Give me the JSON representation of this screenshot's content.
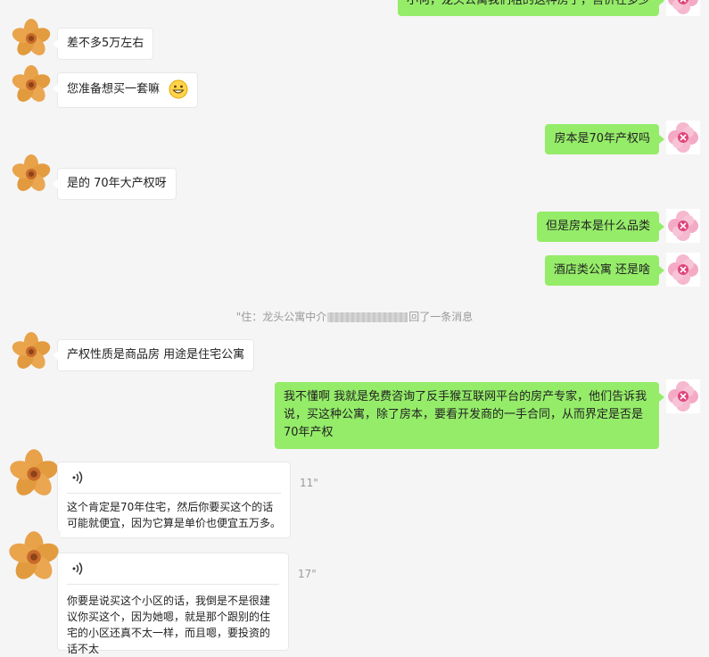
{
  "messages": {
    "m0": "小何，龙头公寓我们租的这种房子，售价在多少",
    "m1": "差不多5万左右",
    "m2": "您准备想买一套嘛",
    "m3": "房本是70年产权吗",
    "m4": "是的 70年大产权呀",
    "m5": "但是房本是什么品类",
    "m6": "酒店类公寓 还是啥",
    "m7": "产权性质是商品房 用途是住宅公寓",
    "m8": "我不懂啊 我就是免费咨询了反手猴互联网平台的房产专家，他们告诉我说，买这种公寓，除了房本，要看开发商的一手合同，从而界定是否是70年产权"
  },
  "recall": {
    "prefix": "\"住：龙头公寓中介",
    "suffix": "回了一条消息"
  },
  "voice1": {
    "duration": "11\"",
    "transcript": "这个肯定是70年住宅，然后你要买这个的话可能就便宜，因为它算是单价也便宜五万多。"
  },
  "voice2": {
    "duration": "17\"",
    "transcript": "你要是说买这个小区的话，我倒是不是很建议你买这个，因为她嗯，就是那个跟别的住宅的小区还真不太一样，而且嗯，要投资的话不太"
  },
  "icons": {
    "left_avatar": "orange-flower-avatar",
    "right_avatar": "pink-flower-avatar",
    "emoji": "grinning-face-emoji",
    "voice": "voice-wave-icon"
  },
  "colors": {
    "outgoing_bubble": "#95ec69",
    "incoming_bubble": "#ffffff",
    "background": "#f5f5f5"
  }
}
